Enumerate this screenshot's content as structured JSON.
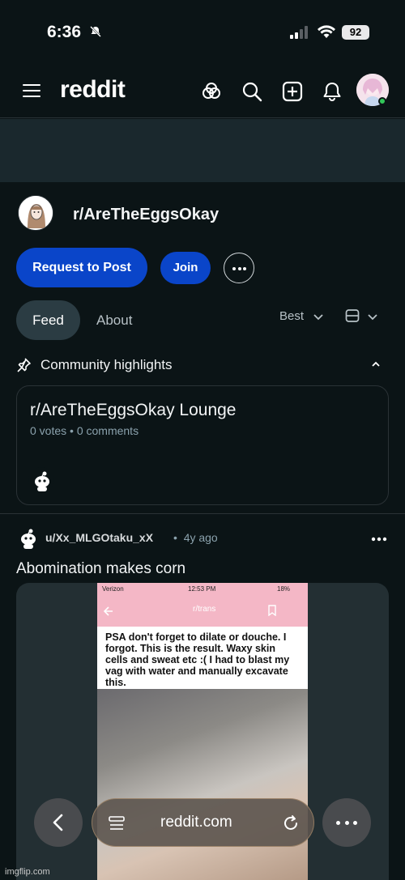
{
  "status_bar": {
    "time": "6:36",
    "battery": "92"
  },
  "header": {
    "logo": "reddit",
    "icons": [
      "menu-icon",
      "popular-icon",
      "search-icon",
      "create-icon",
      "notifications-icon",
      "user-avatar"
    ]
  },
  "subreddit": {
    "name": "r/AreTheEggsOkay",
    "request_label": "Request to Post",
    "join_label": "Join"
  },
  "tabs": {
    "feed": "Feed",
    "about": "About",
    "sort": "Best"
  },
  "highlights": {
    "title": "Community highlights",
    "card": {
      "title": "r/AreTheEggsOkay Lounge",
      "votes": "0 votes",
      "comments": "0 comments"
    }
  },
  "post": {
    "author": "u/Xx_MLGOtaku_xX",
    "age": "4y ago",
    "title": "Abomination makes corn",
    "image": {
      "carrier": "Verizon",
      "time": "12:53 PM",
      "battery": "18%",
      "sub": "r/trans",
      "text": "PSA don't forget to dilate or douche. I forgot. This is the result. Waxy skin cells and sweat etc :( I had to blast my vag with water and manually excavate this."
    }
  },
  "browser": {
    "url": "reddit.com"
  },
  "watermark": "imgflip.com",
  "colors": {
    "bg": "#0b1416",
    "accent": "#0a45c9",
    "banner": "#1a282d"
  }
}
